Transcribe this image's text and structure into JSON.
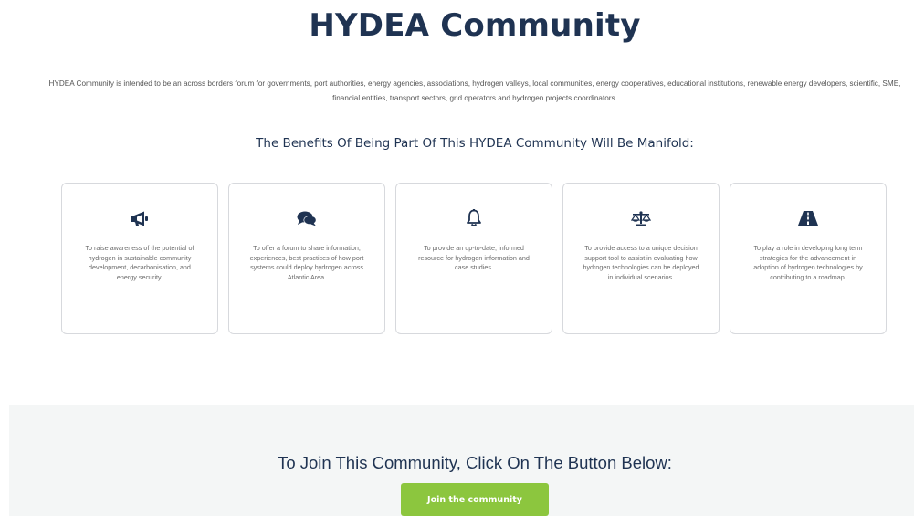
{
  "header": {
    "title": "HYDEA Community"
  },
  "intro": {
    "text": "HYDEA Community is intended to be an across borders forum for governments, port authorities, energy agencies, associations, hydrogen valleys, local communities, energy cooperatives, educational institutions, renewable energy developers, scientific, SME, financial entities, transport sectors, grid operators and hydrogen projects coordinators."
  },
  "benefits": {
    "heading": "The Benefits Of Being Part Of This HYDEA Community Will Be Manifold:",
    "cards": [
      {
        "icon": "megaphone-icon",
        "text": "To raise awareness of the potential of hydrogen in sustainable community development, decarbonisation, and energy security."
      },
      {
        "icon": "comments-icon",
        "text": "To offer a forum to share information, experiences, best practices of how port systems could deploy hydrogen across Atlantic Area."
      },
      {
        "icon": "bell-icon",
        "text": "To provide an up-to-date, informed resource for hydrogen information and case studies."
      },
      {
        "icon": "balance-scale-icon",
        "text": "To provide access to a unique decision support tool to assist in evaluating how hydrogen technologies can be deployed in individual scenarios."
      },
      {
        "icon": "road-icon",
        "text": "To play a role in developing long term strategies for the advancement in adoption of hydrogen technologies by contributing to a roadmap."
      }
    ]
  },
  "join": {
    "heading": "To Join This Community, Click On The Button Below:",
    "button_label": "Join the community"
  },
  "colors": {
    "title": "#1f3352",
    "button": "#8cc63e",
    "section_bg": "#f4f6f6"
  }
}
